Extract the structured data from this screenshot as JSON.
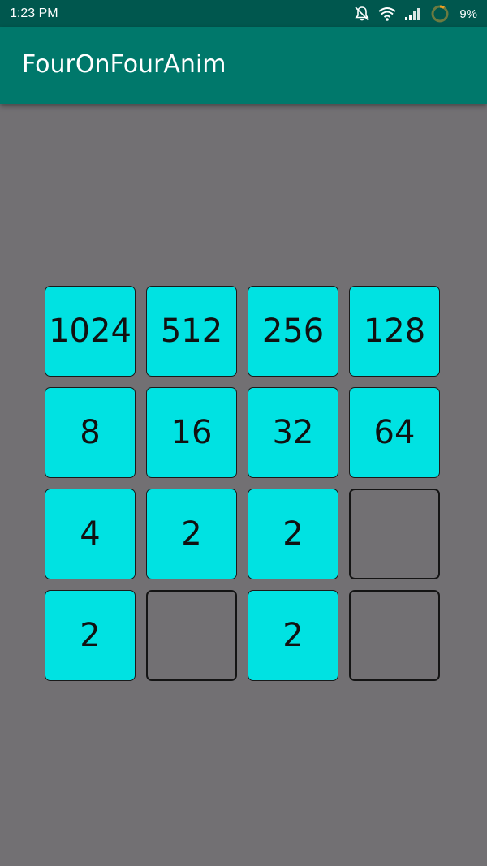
{
  "status_bar": {
    "time": "1:23 PM",
    "battery_percent": "9%",
    "icons": [
      "bell-off-icon",
      "wifi-icon",
      "signal-icon",
      "battery-ring-icon"
    ]
  },
  "app_bar": {
    "title": "FourOnFourAnim",
    "color": "#00786b"
  },
  "board": {
    "tile_color": "#00e2e2",
    "background": "#727073",
    "rows": [
      [
        "1024",
        "512",
        "256",
        "128"
      ],
      [
        "8",
        "16",
        "32",
        "64"
      ],
      [
        "4",
        "2",
        "2",
        ""
      ],
      [
        "2",
        "",
        "2",
        ""
      ]
    ]
  }
}
